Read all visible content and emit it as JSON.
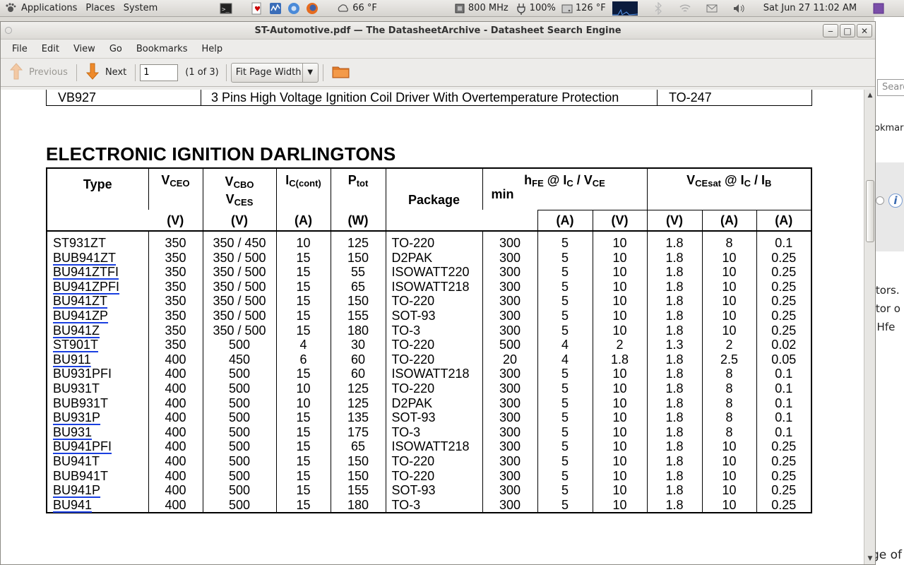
{
  "panel": {
    "applications": "Applications",
    "places": "Places",
    "system": "System",
    "weather": "66 °F",
    "cpu_freq": "800 MHz",
    "battery": "100%",
    "temp": "126 °F",
    "clock": "Sat Jun 27 11:02 AM"
  },
  "window": {
    "title": "ST-Automotive.pdf — The DatasheetArchive - Datasheet Search Engine",
    "menus": [
      "File",
      "Edit",
      "View",
      "Go",
      "Bookmarks",
      "Help"
    ]
  },
  "toolbar": {
    "previous_label": "Previous",
    "next_label": "Next",
    "page_value": "1",
    "page_count": "(1 of 3)",
    "zoom_value": "Fit Page Width"
  },
  "background_window": {
    "search_placeholder": "Searc",
    "text_bookmark": "okmark",
    "text_lines": [
      "stors.",
      "stor o",
      ", Hfe"
    ],
    "bottom_text": "ge of"
  },
  "document": {
    "prev_row": {
      "type": "VB927",
      "description": "3 Pins High Voltage Ignition Coil Driver With Overtemperature Protection",
      "package": "TO-247"
    },
    "section_title": "ELECTRONIC IGNITION DARLINGTONS",
    "headers": {
      "type": "Type",
      "vceo": "V",
      "vceo_sub": "CEO",
      "vcbo": "V",
      "vcbo_sub": "CBO",
      "vces": "V",
      "vces_sub": "CES",
      "ic": "I",
      "ic_sub": "C(cont)",
      "ptot": "P",
      "ptot_sub": "tot",
      "package": "Package",
      "hfe": "h",
      "hfe_sub": "FE",
      "hfe_at": " @ I",
      "hfe_ic_sub": "C",
      "hfe_slash": " / V",
      "hfe_vce_sub": "CE",
      "hfe_min": "min",
      "vcesat": "V",
      "vcesat_sub": "CEsat",
      "vcesat_at": " @ I",
      "vcesat_ic_sub": "C",
      "vcesat_slash": " / I",
      "vcesat_ib_sub": "B",
      "units": [
        "(V)",
        "(V)",
        "(A)",
        "(W)",
        "(A)",
        "(V)",
        "(V)",
        "(A)",
        "(A)"
      ]
    },
    "rows": [
      {
        "type": "ST931ZT",
        "link": false,
        "vceo": "350",
        "vcbo": "350 / 450",
        "ic": "10",
        "ptot": "125",
        "pkg": "TO-220",
        "hfe": "300",
        "hfe_ic": "5",
        "hfe_vce": "10",
        "vsat": "1.8",
        "sat_ic": "8",
        "sat_ib": "0.1"
      },
      {
        "type": "BUB941ZT",
        "link": true,
        "vceo": "350",
        "vcbo": "350 / 500",
        "ic": "15",
        "ptot": "150",
        "pkg": "D2PAK",
        "hfe": "300",
        "hfe_ic": "5",
        "hfe_vce": "10",
        "vsat": "1.8",
        "sat_ic": "10",
        "sat_ib": "0.25"
      },
      {
        "type": "BU941ZTFI",
        "link": true,
        "vceo": "350",
        "vcbo": "350 / 500",
        "ic": "15",
        "ptot": "55",
        "pkg": "ISOWATT220",
        "hfe": "300",
        "hfe_ic": "5",
        "hfe_vce": "10",
        "vsat": "1.8",
        "sat_ic": "10",
        "sat_ib": "0.25"
      },
      {
        "type": "BU941ZPFI",
        "link": true,
        "vceo": "350",
        "vcbo": "350 / 500",
        "ic": "15",
        "ptot": "65",
        "pkg": "ISOWATT218",
        "hfe": "300",
        "hfe_ic": "5",
        "hfe_vce": "10",
        "vsat": "1.8",
        "sat_ic": "10",
        "sat_ib": "0.25"
      },
      {
        "type": "BU941ZT",
        "link": true,
        "vceo": "350",
        "vcbo": "350 / 500",
        "ic": "15",
        "ptot": "150",
        "pkg": "TO-220",
        "hfe": "300",
        "hfe_ic": "5",
        "hfe_vce": "10",
        "vsat": "1.8",
        "sat_ic": "10",
        "sat_ib": "0.25"
      },
      {
        "type": "BU941ZP",
        "link": true,
        "vceo": "350",
        "vcbo": "350 / 500",
        "ic": "15",
        "ptot": "155",
        "pkg": "SOT-93",
        "hfe": "300",
        "hfe_ic": "5",
        "hfe_vce": "10",
        "vsat": "1.8",
        "sat_ic": "10",
        "sat_ib": "0.25"
      },
      {
        "type": "BU941Z",
        "link": true,
        "vceo": "350",
        "vcbo": "350 / 500",
        "ic": "15",
        "ptot": "180",
        "pkg": "TO-3",
        "hfe": "300",
        "hfe_ic": "5",
        "hfe_vce": "10",
        "vsat": "1.8",
        "sat_ic": "10",
        "sat_ib": "0.25"
      },
      {
        "type": "ST901T",
        "link": true,
        "vceo": "350",
        "vcbo": "500",
        "ic": "4",
        "ptot": "30",
        "pkg": "TO-220",
        "hfe": "500",
        "hfe_ic": "4",
        "hfe_vce": "2",
        "vsat": "1.3",
        "sat_ic": "2",
        "sat_ib": "0.02"
      },
      {
        "type": "BU911",
        "link": true,
        "vceo": "400",
        "vcbo": "450",
        "ic": "6",
        "ptot": "60",
        "pkg": "TO-220",
        "hfe": "20",
        "hfe_ic": "4",
        "hfe_vce": "1.8",
        "vsat": "1.8",
        "sat_ic": "2.5",
        "sat_ib": "0.05"
      },
      {
        "type": "BU931PFI",
        "link": false,
        "vceo": "400",
        "vcbo": "500",
        "ic": "15",
        "ptot": "60",
        "pkg": "ISOWATT218",
        "hfe": "300",
        "hfe_ic": "5",
        "hfe_vce": "10",
        "vsat": "1.8",
        "sat_ic": "8",
        "sat_ib": "0.1"
      },
      {
        "type": "BU931T",
        "link": false,
        "vceo": "400",
        "vcbo": "500",
        "ic": "10",
        "ptot": "125",
        "pkg": "TO-220",
        "hfe": "300",
        "hfe_ic": "5",
        "hfe_vce": "10",
        "vsat": "1.8",
        "sat_ic": "8",
        "sat_ib": "0.1"
      },
      {
        "type": "BUB931T",
        "link": false,
        "vceo": "400",
        "vcbo": "500",
        "ic": "10",
        "ptot": "125",
        "pkg": "D2PAK",
        "hfe": "300",
        "hfe_ic": "5",
        "hfe_vce": "10",
        "vsat": "1.8",
        "sat_ic": "8",
        "sat_ib": "0.1"
      },
      {
        "type": "BU931P",
        "link": true,
        "vceo": "400",
        "vcbo": "500",
        "ic": "15",
        "ptot": "135",
        "pkg": "SOT-93",
        "hfe": "300",
        "hfe_ic": "5",
        "hfe_vce": "10",
        "vsat": "1.8",
        "sat_ic": "8",
        "sat_ib": "0.1"
      },
      {
        "type": "BU931",
        "link": true,
        "vceo": "400",
        "vcbo": "500",
        "ic": "15",
        "ptot": "175",
        "pkg": "TO-3",
        "hfe": "300",
        "hfe_ic": "5",
        "hfe_vce": "10",
        "vsat": "1.8",
        "sat_ic": "8",
        "sat_ib": "0.1"
      },
      {
        "type": "BU941PFI",
        "link": true,
        "vceo": "400",
        "vcbo": "500",
        "ic": "15",
        "ptot": "65",
        "pkg": "ISOWATT218",
        "hfe": "300",
        "hfe_ic": "5",
        "hfe_vce": "10",
        "vsat": "1.8",
        "sat_ic": "10",
        "sat_ib": "0.25"
      },
      {
        "type": "BU941T",
        "link": false,
        "vceo": "400",
        "vcbo": "500",
        "ic": "15",
        "ptot": "150",
        "pkg": "TO-220",
        "hfe": "300",
        "hfe_ic": "5",
        "hfe_vce": "10",
        "vsat": "1.8",
        "sat_ic": "10",
        "sat_ib": "0.25"
      },
      {
        "type": "BUB941T",
        "link": false,
        "vceo": "400",
        "vcbo": "500",
        "ic": "15",
        "ptot": "150",
        "pkg": "TO-220",
        "hfe": "300",
        "hfe_ic": "5",
        "hfe_vce": "10",
        "vsat": "1.8",
        "sat_ic": "10",
        "sat_ib": "0.25"
      },
      {
        "type": "BU941P",
        "link": true,
        "vceo": "400",
        "vcbo": "500",
        "ic": "15",
        "ptot": "155",
        "pkg": "SOT-93",
        "hfe": "300",
        "hfe_ic": "5",
        "hfe_vce": "10",
        "vsat": "1.8",
        "sat_ic": "10",
        "sat_ib": "0.25"
      },
      {
        "type": "BU941",
        "link": true,
        "vceo": "400",
        "vcbo": "500",
        "ic": "15",
        "ptot": "180",
        "pkg": "TO-3",
        "hfe": "300",
        "hfe_ic": "5",
        "hfe_vce": "10",
        "vsat": "1.8",
        "sat_ic": "10",
        "sat_ib": "0.25"
      }
    ]
  }
}
